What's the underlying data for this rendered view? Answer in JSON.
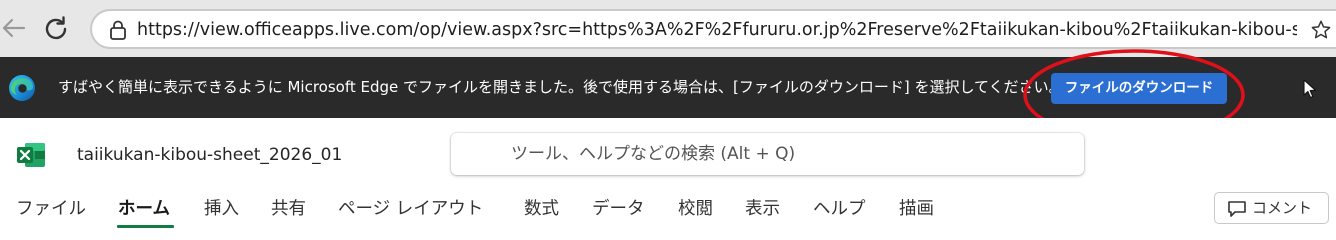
{
  "browser": {
    "url": "https://view.officeapps.live.com/op/view.aspx?src=https%3A%2F%2Ffururu.or.jp%2Freserve%2Ftaiikukan-kibou%2Ftaiikukan-kibou-sheet_...",
    "icons": [
      "back-arrow-icon",
      "refresh-icon",
      "lock-icon",
      "favorite-star-icon"
    ]
  },
  "notification": {
    "text": "すばやく簡単に表示できるように Microsoft Edge でファイルを開きました。後で使用する場合は、[ファイルのダウンロード] を選択してください。",
    "download_button": "ファイルのダウンロード",
    "highlight_color": "#e0101a",
    "button_color": "#2b6fd3"
  },
  "excel": {
    "doc_title": "taiikukan-kibou-sheet_2026_01",
    "search_placeholder": "ツール、ヘルプなどの検索 (Alt + Q)",
    "tabs": [
      "ファイル",
      "ホーム",
      "挿入",
      "共有",
      "ページ レイアウト",
      "数式",
      "データ",
      "校閲",
      "表示",
      "ヘルプ",
      "描画"
    ],
    "active_tab": "ホーム",
    "comment_button": "コメント",
    "accent_color": "#107c41"
  }
}
